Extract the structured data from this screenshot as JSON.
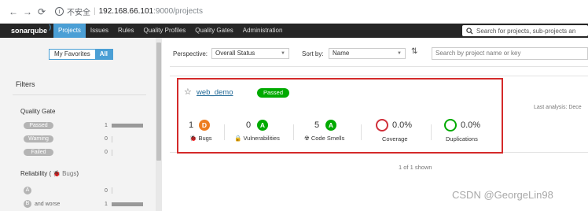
{
  "browser": {
    "insecure_label": "不安全",
    "url_host": "192.168.66.101",
    "url_path": ":9000/projects"
  },
  "nav": {
    "logo": "sonarqube",
    "items": [
      "Projects",
      "Issues",
      "Rules",
      "Quality Profiles",
      "Quality Gates",
      "Administration"
    ],
    "search_placeholder": "Search for projects, sub-projects an"
  },
  "sidebar": {
    "my_favorites": "My Favorites",
    "all": "All",
    "filters_title": "Filters",
    "quality_gate": {
      "title": "Quality Gate",
      "rows": [
        {
          "label": "Passed",
          "count": "1"
        },
        {
          "label": "Warning",
          "count": "0"
        },
        {
          "label": "Failed",
          "count": "0"
        }
      ]
    },
    "reliability": {
      "title": "Reliability (",
      "subtitle": "Bugs",
      "title_end": ")",
      "rows": [
        {
          "rating": "A",
          "label": "",
          "count": "0"
        },
        {
          "rating": "B",
          "label": "and worse",
          "count": "1"
        }
      ]
    }
  },
  "toolbar": {
    "perspective_label": "Perspective:",
    "perspective_value": "Overall Status",
    "sort_label": "Sort by:",
    "sort_value": "Name",
    "search_placeholder": "Search by project name or key"
  },
  "project": {
    "name": "web_demo",
    "status": "Passed",
    "last_analysis": "Last analysis: Dece",
    "metrics": [
      {
        "value": "1",
        "rating": "D",
        "label": "Bugs",
        "icon": "bug-icon"
      },
      {
        "value": "0",
        "rating": "A",
        "label": "Vulnerabilities",
        "icon": "lock-icon"
      },
      {
        "value": "5",
        "rating": "A",
        "label": "Code Smells",
        "icon": "code-smell-icon"
      },
      {
        "value": "0.0%",
        "label": "Coverage"
      },
      {
        "value": "0.0%",
        "label": "Duplications"
      }
    ]
  },
  "shown_count": "1 of 1 shown",
  "watermark": "CSDN @GeorgeLin98",
  "colors": {
    "accent": "#4b9fd5",
    "passed": "#00aa00",
    "rating_a": "#00aa00",
    "rating_d": "#ed7d20",
    "coverage_ring": "#d02f3a",
    "duplication_ring": "#00aa00",
    "highlight": "#d42a2a"
  }
}
